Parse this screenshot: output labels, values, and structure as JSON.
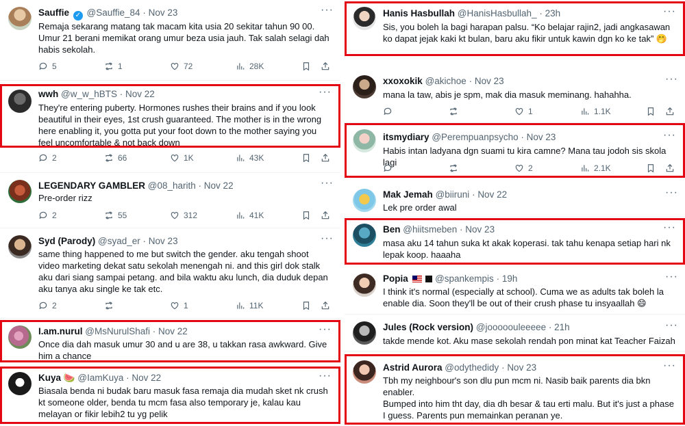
{
  "left": [
    {
      "name": "Sauffie",
      "handle": "@Sauffie_84",
      "date": "Nov 23",
      "verified": true,
      "text": "Remaja sekarang matang tak macam kita usia 20 sekitar tahun 90 00. Umur 21 berani memikat orang umur beza usia jauh. Tak salah selagi dah habis sekolah.",
      "reply": "5",
      "retweet": "1",
      "like": "72",
      "views": "28K"
    },
    {
      "name": "wwh",
      "handle": "@w_w_hBTS",
      "date": "Nov 22",
      "text": "They're entering puberty. Hormones rushes their brains and if you look beautiful in their eyes, 1st crush guaranteed. The mother is in the wrong here enabling it, you gotta put your foot down to the mother saying you feel uncomfortable & not back down",
      "reply": "2",
      "retweet": "66",
      "like": "1K",
      "views": "43K"
    },
    {
      "name": "LEGENDARY GAMBLER",
      "handle": "@08_harith",
      "date": "Nov 22",
      "text": "Pre-order rizz",
      "reply": "2",
      "retweet": "55",
      "like": "312",
      "views": "41K"
    },
    {
      "name": "Syd (Parody)",
      "handle": "@syad_er",
      "date": "Nov 23",
      "text": "same thing happened to me but switch the gender. aku tengah shoot video marketing dekat satu sekolah menengah ni. and this girl dok stalk aku dari siang sampai petang. and bila waktu aku lunch, dia duduk depan aku tanya aku single ke tak etc.",
      "reply": "2",
      "retweet": "",
      "like": "1",
      "views": "11K"
    },
    {
      "name": "I.am.nurul",
      "handle": "@MsNurulShafi",
      "date": "Nov 22",
      "text": "Once dia dah masuk umur 30 and u are 38, u takkan rasa awkward. Give him a chance"
    },
    {
      "name": "Kuya",
      "name_emoji": "🍉",
      "handle": "@IamKuya",
      "date": "Nov 22",
      "text": "Biasala benda ni budak baru masuk fasa remaja dia mudah sket nk crush kt someone older, benda tu mcm fasa also temporary je, kalau kau melayan or fikir lebih2 tu yg pelik"
    }
  ],
  "right": [
    {
      "name": "Hanis Hasbullah",
      "handle": "@HanisHasbullah_",
      "date": "23h",
      "text": "Sis, you boleh la bagi harapan palsu. “Ko belajar rajin2, jadi angkasawan ko dapat jejak kaki kt bulan, baru aku fikir untuk kawin dgn ko ke tak” 🤭"
    },
    {
      "name": "xxoxokik",
      "handle": "@akichoe",
      "date": "Nov 23",
      "text": "mana la taw, abis je spm, mak dia masuk meminang. hahahha.",
      "reply": "",
      "retweet": "",
      "like": "1",
      "views": "1.1K"
    },
    {
      "name": "itsmydiary",
      "handle": "@Perempuanpsycho",
      "date": "Nov 23",
      "text": "Habis intan ladyana dgn suami tu kira camne? Mana tau jodoh sis skola lagi",
      "reply": "",
      "retweet": "",
      "like": "2",
      "views": "2.1K"
    },
    {
      "name": "Mak Jemah",
      "handle": "@biiruni",
      "date": "Nov 22",
      "text": "Lek pre order awal"
    },
    {
      "name": "Ben",
      "handle": "@hiitsmeben",
      "date": "Nov 23",
      "text": "masa aku 14 tahun suka kt akak koperasi. tak tahu kenapa setiap hari nk lepak koop.  haaaha"
    },
    {
      "name": "Popia",
      "handle": "@spankempis",
      "date": "19h",
      "text": "I think it's normal (especially at school). Cuma we as adults tak boleh la enable dia. Soon they'll be out of their crush phase tu insyaallah 😄"
    },
    {
      "name": "Jules (Rock version)",
      "handle": "@jooooouleeeee",
      "date": "21h",
      "text": "takde mende kot. Aku mase sekolah rendah pon minat kat Teacher Faizah"
    },
    {
      "name": "Astrid Aurora",
      "handle": "@odythedidy",
      "date": "Nov 23",
      "text": "Tbh my neighbour's son dlu pun mcm ni. Nasib baik parents dia bkn enabler.",
      "text2": "Bumped into him tht day, dia dh besar & tau erti malu. But it's just a phase I guess. Parents pun memainkan peranan ye."
    }
  ],
  "colors": {
    "highlight": "#e30613",
    "text": "#0f1419",
    "muted": "#536471",
    "verified": "#1d9bf0"
  }
}
